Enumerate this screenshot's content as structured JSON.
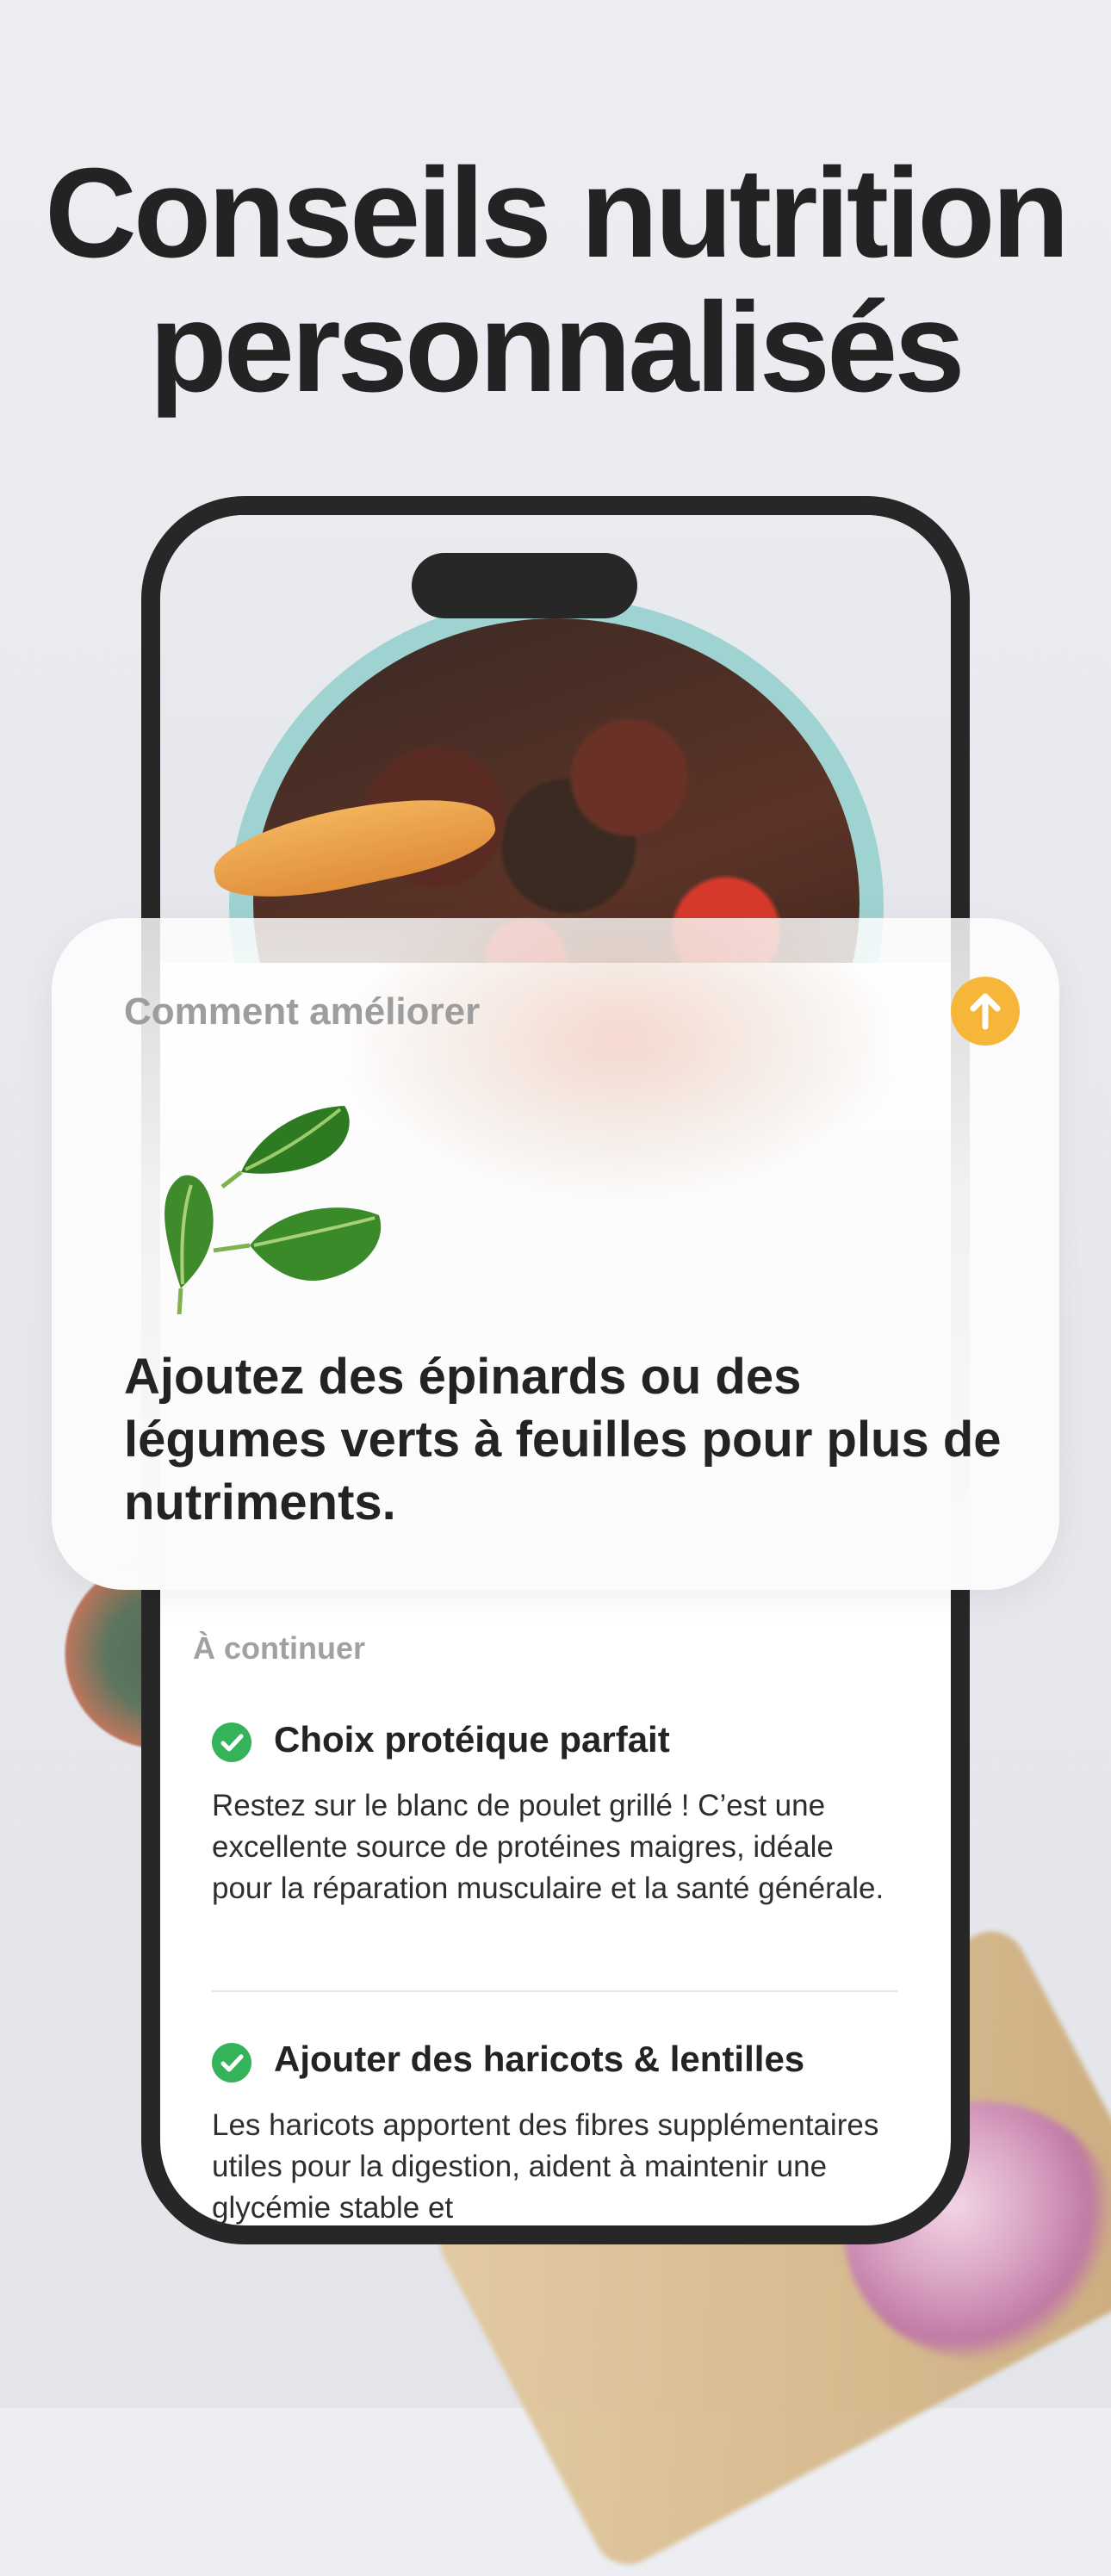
{
  "headline": {
    "line1": "Conseils nutrition",
    "line2": "personnalisés"
  },
  "card": {
    "title": "Comment améliorer",
    "tip": "Ajoutez des épinards ou des légumes verts à feuilles pour plus de nutriments.",
    "action_icon": "arrow-up-icon",
    "image_icon": "spinach-leaves-icon"
  },
  "list": {
    "section_label": "À continuer",
    "items": [
      {
        "title": "Choix protéique parfait",
        "description": "Restez sur le blanc de poulet grillé ! C’est une excellente source de protéines maigres, idéale pour la réparation musculaire et la santé générale.",
        "icon": "check-circle-icon"
      },
      {
        "title": "Ajouter des haricots & lentilles",
        "description": "Les haricots apportent des fibres supplémentaires utiles pour la digestion, aident à maintenir une glycémie stable et",
        "icon": "check-circle-icon"
      }
    ]
  },
  "colors": {
    "accent": "#f6b63a",
    "check": "#34b35a",
    "text": "#232323",
    "muted": "#9d9d9d",
    "phone_frame": "#272727"
  }
}
